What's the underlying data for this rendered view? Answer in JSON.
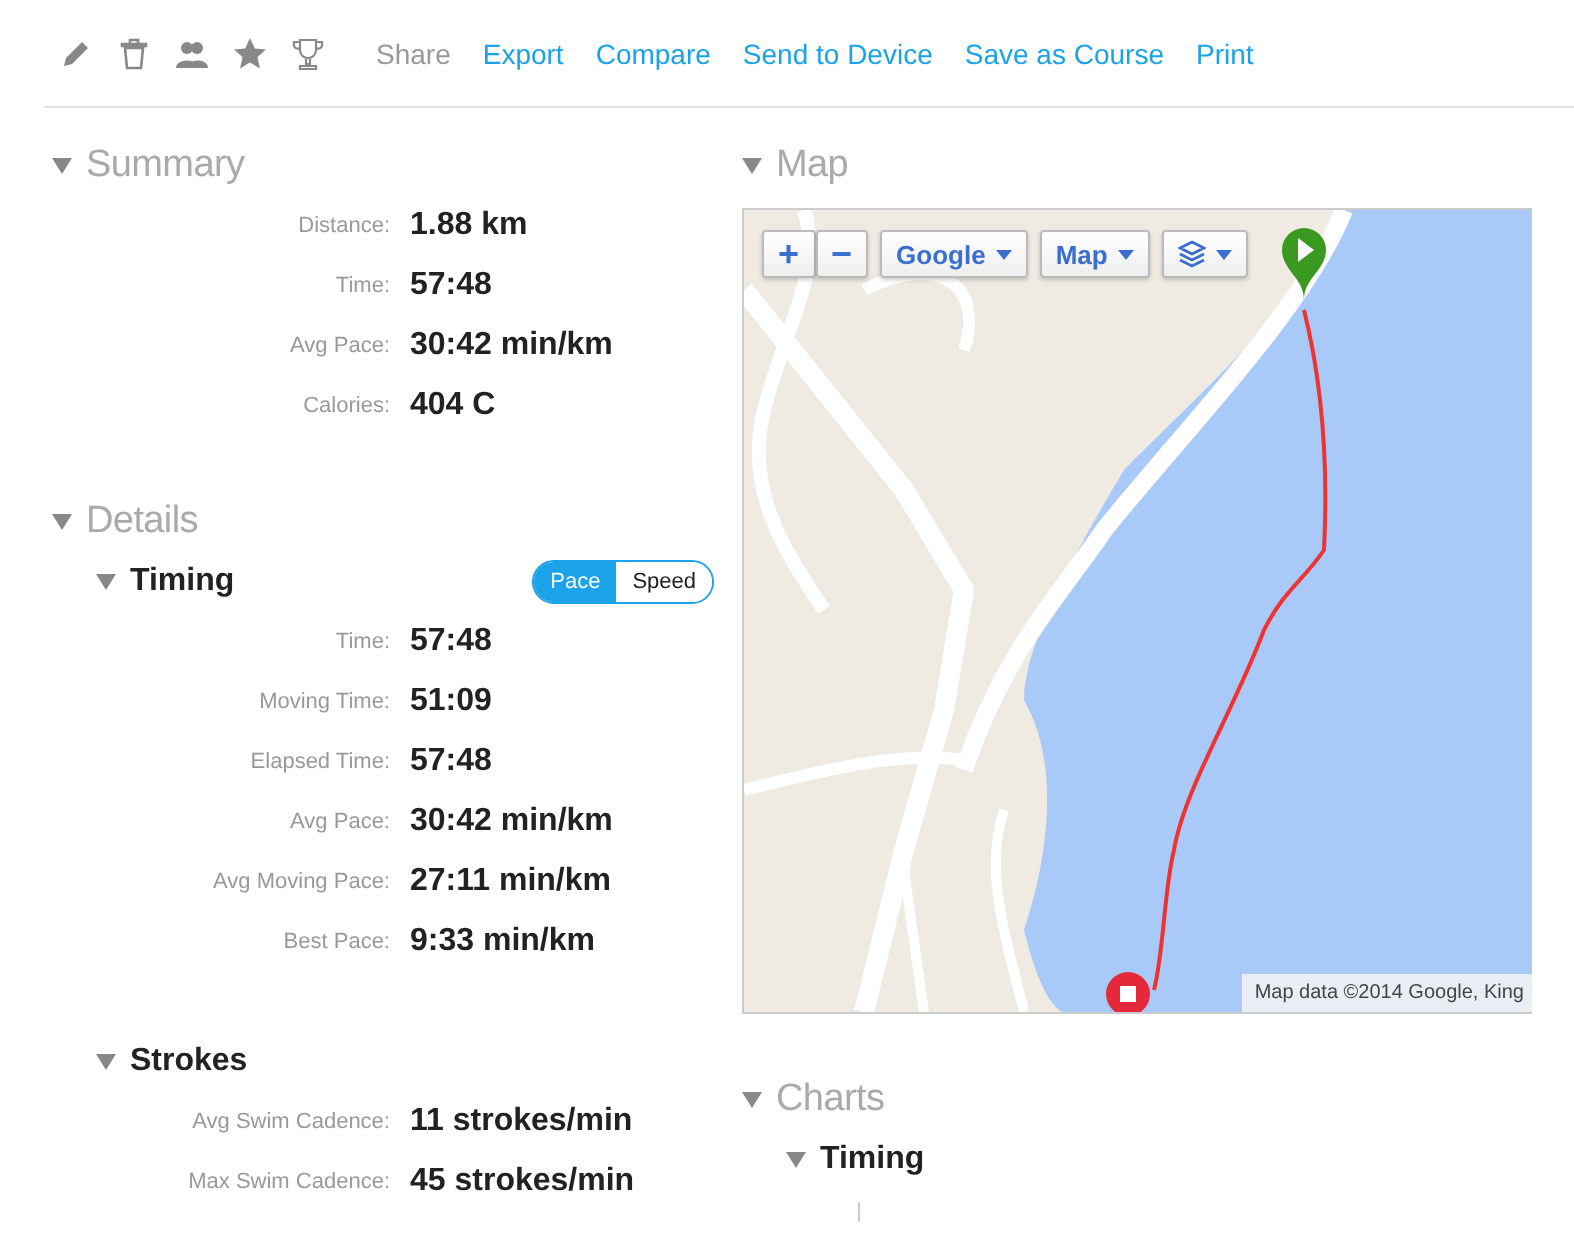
{
  "toolbar": {
    "icons": [
      {
        "kind": "pencil"
      },
      {
        "kind": "trash"
      },
      {
        "kind": "people"
      },
      {
        "kind": "star"
      },
      {
        "kind": "trophy"
      }
    ],
    "actions": [
      {
        "label": "Share",
        "disabled": true
      },
      {
        "label": "Export",
        "disabled": false
      },
      {
        "label": "Compare",
        "disabled": false
      },
      {
        "label": "Send to Device",
        "disabled": false
      },
      {
        "label": "Save as Course",
        "disabled": false
      },
      {
        "label": "Print",
        "disabled": false
      }
    ]
  },
  "summary": {
    "title": "Summary",
    "expanded": true,
    "rows": [
      {
        "label": "Distance:",
        "value": "1.88 km"
      },
      {
        "label": "Time:",
        "value": "57:48"
      },
      {
        "label": "Avg Pace:",
        "value": "30:42 min/km"
      },
      {
        "label": "Calories:",
        "value": "404 C"
      }
    ]
  },
  "details": {
    "title": "Details",
    "expanded": true,
    "sections": [
      {
        "title": "Timing",
        "expanded": true,
        "toggle": [
          {
            "label": "Pace",
            "selected": true
          },
          {
            "label": "Speed",
            "selected": false
          }
        ],
        "rows": [
          {
            "label": "Time:",
            "value": "57:48"
          },
          {
            "label": "Moving Time:",
            "value": "51:09"
          },
          {
            "label": "Elapsed Time:",
            "value": "57:48"
          },
          {
            "label": "Avg Pace:",
            "value": "30:42 min/km"
          },
          {
            "label": "Avg Moving Pace:",
            "value": "27:11 min/km"
          },
          {
            "label": "Best Pace:",
            "value": "9:33 min/km"
          }
        ]
      },
      {
        "title": "Strokes",
        "expanded": true,
        "rows": [
          {
            "label": "Avg Swim Cadence:",
            "value": "11 strokes/min"
          },
          {
            "label": "Max Swim Cadence:",
            "value": "45 strokes/min"
          }
        ]
      }
    ]
  },
  "map": {
    "title": "Map",
    "expanded": true,
    "zoom_in": "+",
    "zoom_out": "−",
    "provider": "Google",
    "map_type": "Map",
    "attribution": "Map data ©2014 Google, King"
  },
  "charts": {
    "title": "Charts",
    "expanded": true,
    "sections": [
      {
        "title": "Timing",
        "expanded": true
      }
    ]
  }
}
